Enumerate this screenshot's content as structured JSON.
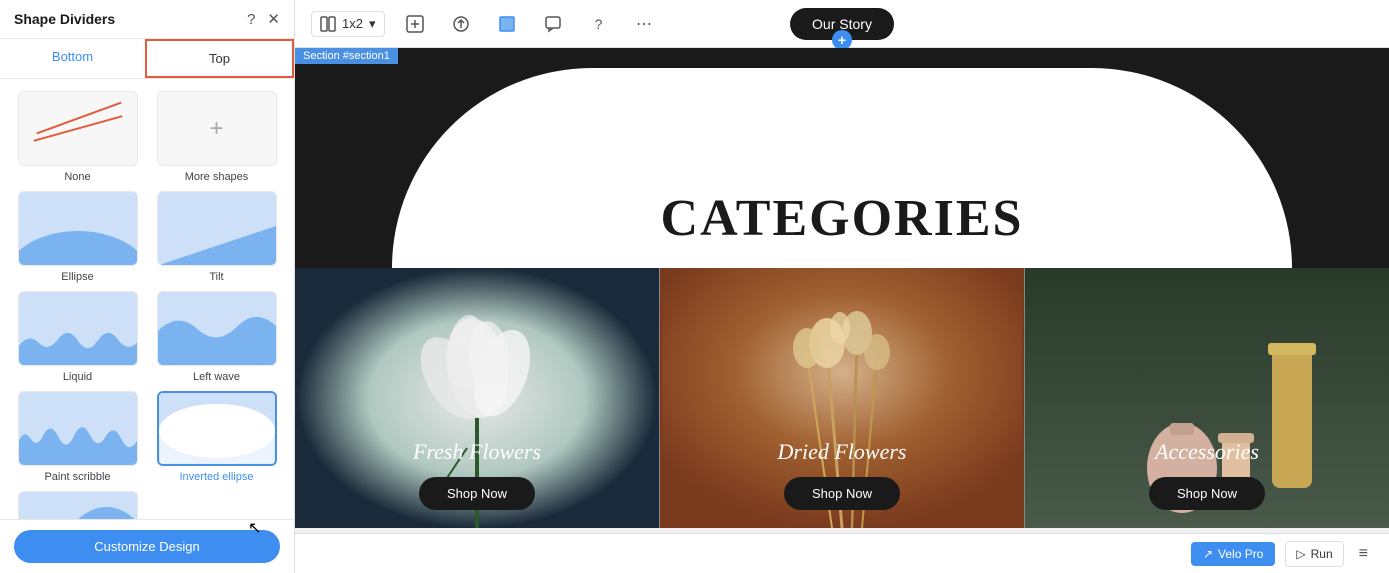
{
  "panel": {
    "title": "Shape Dividers",
    "help_icon": "?",
    "close_icon": "✕",
    "tabs": [
      {
        "id": "bottom",
        "label": "Bottom",
        "state": "inactive"
      },
      {
        "id": "top",
        "label": "Top",
        "state": "active"
      }
    ],
    "shapes": [
      {
        "id": "none",
        "label": "None",
        "type": "none"
      },
      {
        "id": "more-shapes",
        "label": "More shapes",
        "type": "more"
      },
      {
        "id": "ellipse",
        "label": "Ellipse",
        "type": "ellipse"
      },
      {
        "id": "tilt",
        "label": "Tilt",
        "type": "tilt"
      },
      {
        "id": "liquid",
        "label": "Liquid",
        "type": "liquid"
      },
      {
        "id": "left-wave",
        "label": "Left wave",
        "type": "leftwave"
      },
      {
        "id": "paint-scribble",
        "label": "Paint scribble",
        "type": "paintscribble"
      },
      {
        "id": "inverted-ellipse",
        "label": "Inverted ellipse",
        "type": "invertedellipse",
        "selected": true
      }
    ],
    "partial_shapes": [
      {
        "id": "bottom-shape",
        "label": "",
        "type": "partial"
      }
    ],
    "customize_btn": "Customize Design"
  },
  "toolbar": {
    "layout_label": "1x2",
    "nav_label": "Our Story",
    "plus_symbol": "+",
    "more_icon": "⋯",
    "question_icon": "?",
    "chat_icon": "💬",
    "grid_icon": "⊞",
    "upload_icon": "⬆",
    "crop_icon": "⊡",
    "expand_icon": "⤢"
  },
  "canvas": {
    "section_label": "Section #section1",
    "categories_text": "CATEGORIES",
    "cards": [
      {
        "id": "fresh-flowers",
        "title": "Fresh Flowers",
        "btn_label": "Shop Now",
        "bg": "dark"
      },
      {
        "id": "dried-flowers",
        "title": "Dried Flowers",
        "btn_label": "Shop Now",
        "bg": "rust"
      },
      {
        "id": "accessories",
        "title": "Accessories",
        "btn_label": "Shop Now",
        "bg": "green"
      }
    ]
  },
  "bottom_bar": {
    "velo_pro_label": "Velo Pro",
    "run_label": "Run",
    "arrow_icon": "↗"
  }
}
